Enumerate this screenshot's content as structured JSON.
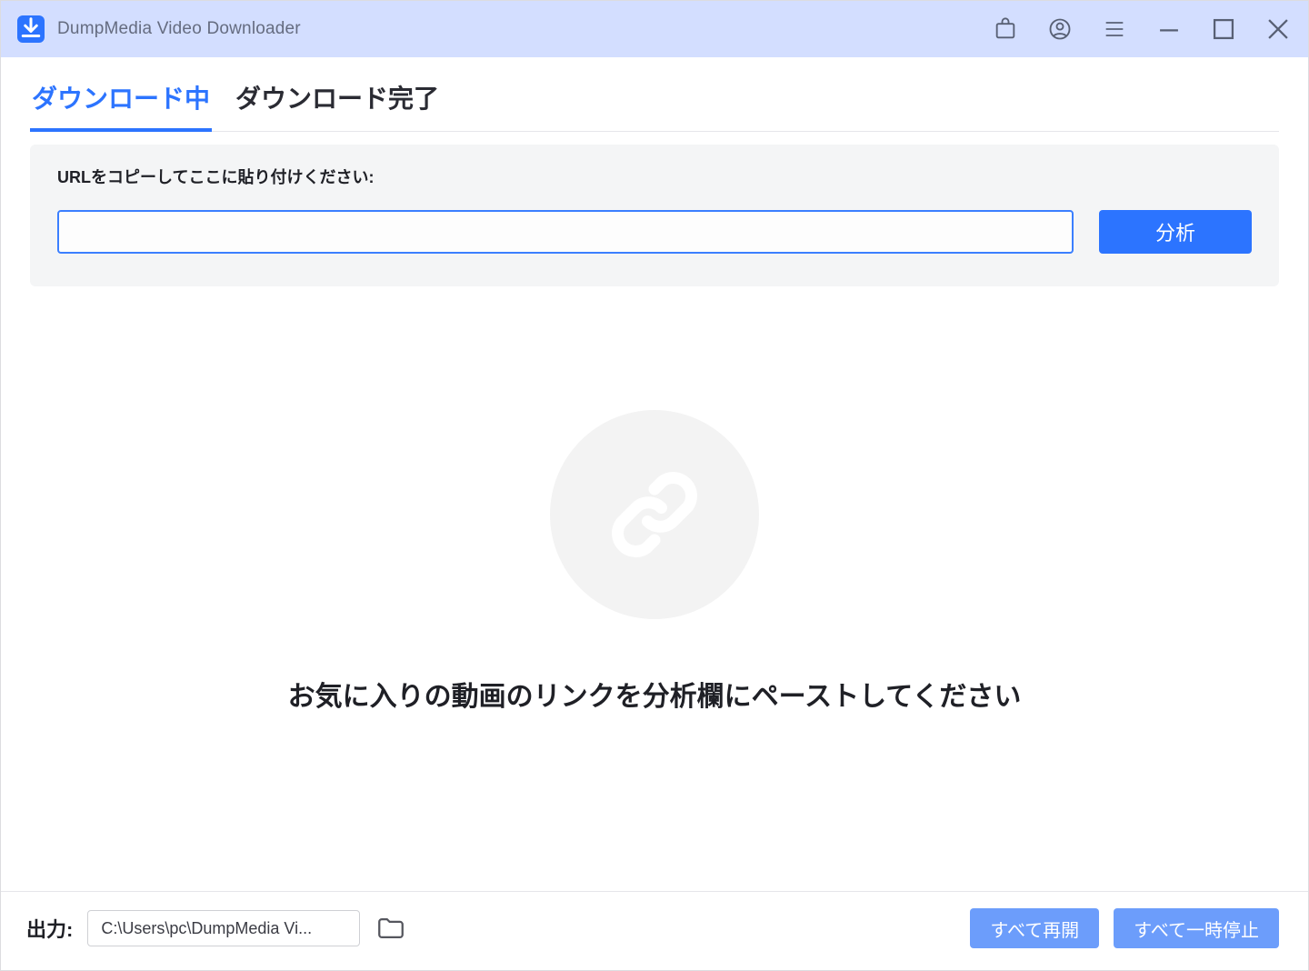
{
  "app": {
    "title": "DumpMedia Video Downloader"
  },
  "tabs": {
    "downloading": "ダウンロード中",
    "completed": "ダウンロード完了"
  },
  "urlpanel": {
    "label": "URLをコピーしてここに貼り付けください:",
    "input_value": "",
    "analyze": "分析"
  },
  "empty": {
    "message": "お気に入りの動画のリンクを分析欄にペーストしてください"
  },
  "footer": {
    "output_label": "出力:",
    "output_path": "C:\\Users\\pc\\DumpMedia Vi...",
    "resume_all": "すべて再開",
    "pause_all": "すべて一時停止"
  }
}
